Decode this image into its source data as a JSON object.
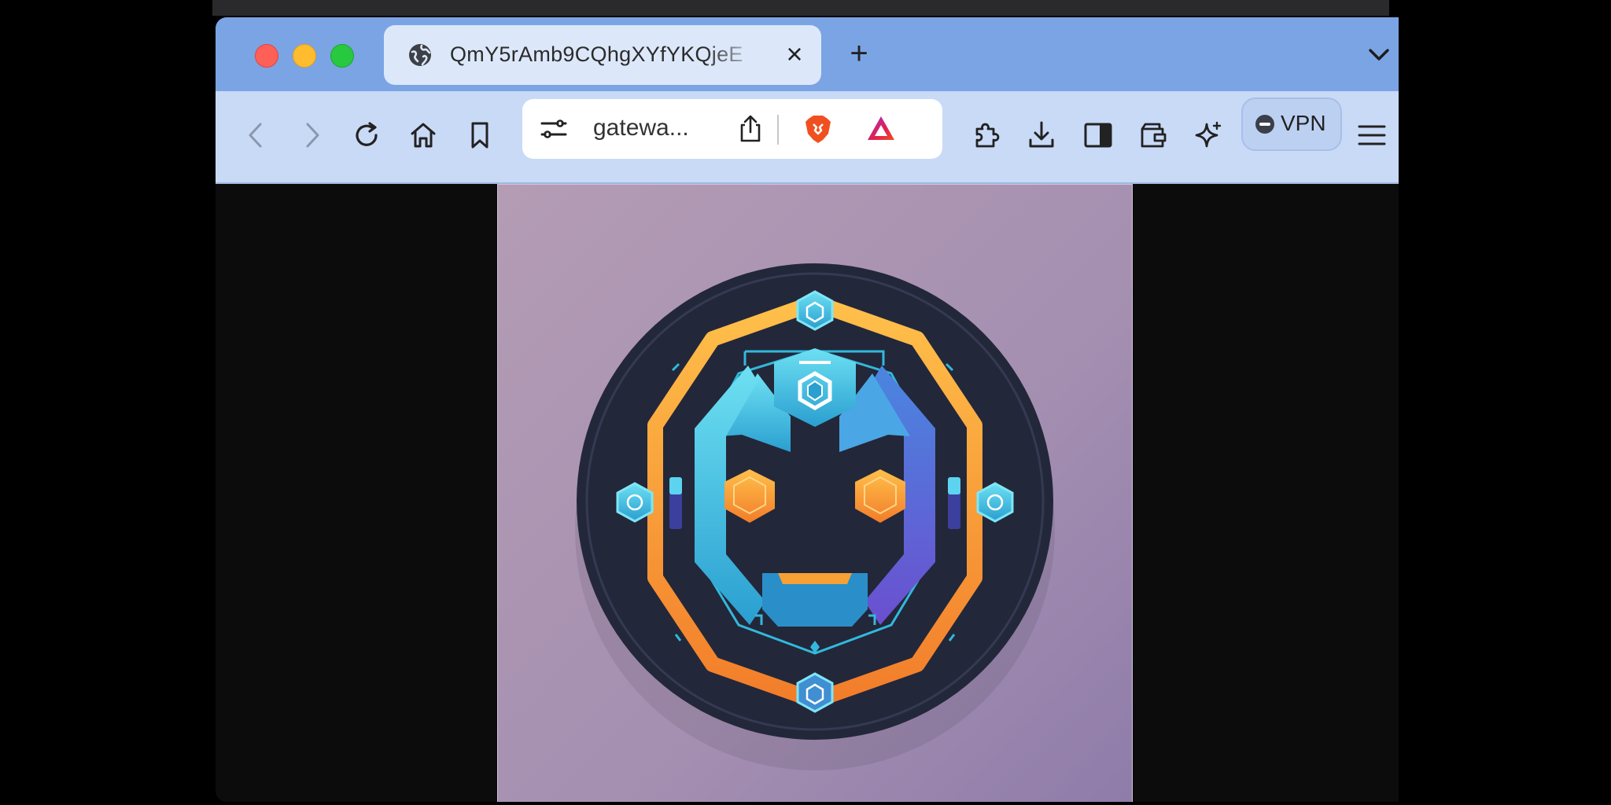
{
  "browser": {
    "tab": {
      "title": "QmY5rAmb9CQhgXYfYKQjeE",
      "close_glyph": "×",
      "favicon": "globe-icon"
    },
    "new_tab_glyph": "+",
    "toolbar": {
      "back": "chevron-left-icon",
      "forward": "chevron-right-icon",
      "reload": "reload-icon",
      "home": "home-icon",
      "bookmark": "bookmark-icon",
      "address": {
        "display_url": "gatewa...",
        "site_settings": "sliders-icon",
        "share": "share-icon",
        "brave_shields": "brave-lion-icon",
        "rewards": "rewards-triangle-icon"
      },
      "extensions": "puzzle-icon",
      "downloads": "download-icon",
      "sidebar": "sidebar-icon",
      "wallet": "wallet-icon",
      "leo": "sparkle-icon",
      "vpn_label": "VPN",
      "menu": "hamburger-icon"
    }
  },
  "colors": {
    "tabstrip": "#7aa4e4",
    "toolbar": "#c9daf7",
    "active_tab": "#dce8fa",
    "page_background": "#0c0c0c",
    "image_background": "#a892b3",
    "badge_dark": "#23273a",
    "accent_orange": "#f7a035",
    "accent_cyan": "#3ec9e6",
    "accent_purple": "#6b5bd6"
  },
  "page": {
    "image": "robot-face-emblem-image"
  }
}
